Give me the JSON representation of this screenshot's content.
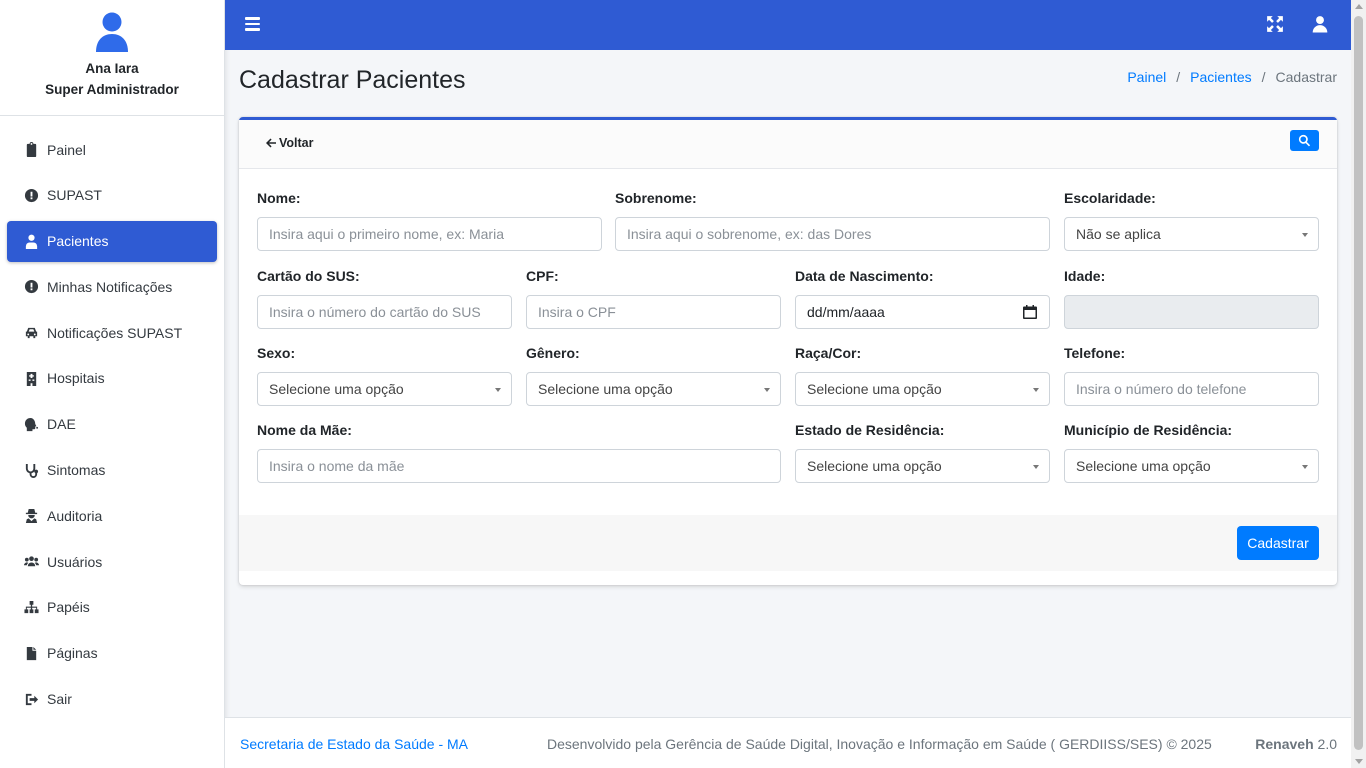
{
  "user": {
    "name": "Ana Iara",
    "role": "Super Administrador"
  },
  "sidebar": {
    "items": [
      {
        "label": "Painel",
        "icon": "clipboard-icon"
      },
      {
        "label": "SUPAST",
        "icon": "exclamation-circle-icon"
      },
      {
        "label": "Pacientes",
        "icon": "user-injured-icon",
        "active": true
      },
      {
        "label": "Minhas Notificações",
        "icon": "exclamation-circle-icon"
      },
      {
        "label": "Notificações SUPAST",
        "icon": "car-icon"
      },
      {
        "label": "Hospitais",
        "icon": "hospital-icon"
      },
      {
        "label": "DAE",
        "icon": "head-virus-icon"
      },
      {
        "label": "Sintomas",
        "icon": "stethoscope-icon"
      },
      {
        "label": "Auditoria",
        "icon": "user-secret-icon"
      },
      {
        "label": "Usuários",
        "icon": "users-icon"
      },
      {
        "label": "Papéis",
        "icon": "sitemap-icon"
      },
      {
        "label": "Páginas",
        "icon": "file-icon"
      },
      {
        "label": "Sair",
        "icon": "sign-out-icon"
      }
    ]
  },
  "header": {
    "title": "Cadastrar Pacientes",
    "breadcrumb": [
      "Painel",
      "Pacientes",
      "Cadastrar"
    ]
  },
  "card": {
    "back_label": "Voltar",
    "search_icon": "search-icon"
  },
  "form": {
    "nome": {
      "label": "Nome:",
      "placeholder": "Insira aqui o primeiro nome, ex: Maria"
    },
    "sobrenome": {
      "label": "Sobrenome:",
      "placeholder": "Insira aqui o sobrenome, ex: das Dores"
    },
    "escolaridade": {
      "label": "Escolaridade:",
      "value": "Não se aplica"
    },
    "cartao_sus": {
      "label": "Cartão do SUS:",
      "placeholder": "Insira o número do cartão do SUS"
    },
    "cpf": {
      "label": "CPF:",
      "placeholder": "Insira o CPF"
    },
    "data_nascimento": {
      "label": "Data de Nascimento:",
      "value": "dd/mm/aaaa"
    },
    "idade": {
      "label": "Idade:",
      "value": ""
    },
    "sexo": {
      "label": "Sexo:",
      "value": "Selecione uma opção"
    },
    "genero": {
      "label": "Gênero:",
      "value": "Selecione uma opção"
    },
    "raca_cor": {
      "label": "Raça/Cor:",
      "value": "Selecione uma opção"
    },
    "telefone": {
      "label": "Telefone:",
      "placeholder": "Insira o número do telefone"
    },
    "nome_mae": {
      "label": "Nome da Mãe:",
      "placeholder": "Insira o nome da mãe"
    },
    "estado_residencia": {
      "label": "Estado de Residência:",
      "value": "Selecione uma opção"
    },
    "municipio_residencia": {
      "label": "Município de Residência:",
      "value": "Selecione uma opção"
    },
    "submit_label": "Cadastrar"
  },
  "footer": {
    "left": "Secretaria de Estado da Saúde - MA",
    "center": "Desenvolvido pela Gerência de Saúde Digital, Inovação e Informação em Saúde ( GERDIISS/SES) © 2025",
    "brand": "Renaveh",
    "version": "2.0"
  },
  "colors": {
    "primary": "#2f5bd3",
    "accent": "#007bff",
    "background": "#f4f6f9"
  }
}
